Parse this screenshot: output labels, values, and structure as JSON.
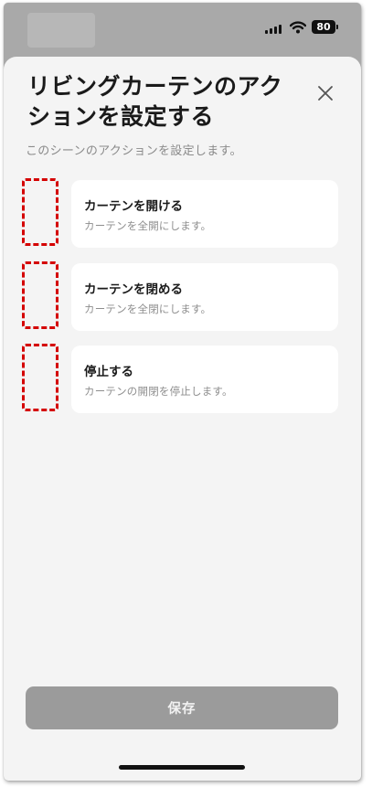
{
  "status_bar": {
    "battery_level": "80",
    "icons": [
      "cellular-signal-icon",
      "wifi-icon",
      "battery-icon"
    ]
  },
  "sheet": {
    "title": "リビングカーテンのアクションを設定する",
    "subtitle": "このシーンのアクションを設定します。",
    "close_icon": "close-icon"
  },
  "actions": [
    {
      "label": "カーテンを開ける",
      "description": "カーテンを全開にします。"
    },
    {
      "label": "カーテンを閉める",
      "description": "カーテンを全閉にします。"
    },
    {
      "label": "停止する",
      "description": "カーテンの開閉を停止します。"
    }
  ],
  "footer": {
    "save_label": "保存"
  },
  "colors": {
    "sheet_background": "#f4f4f4",
    "card_background": "#ffffff",
    "save_button_disabled": "#9b9b9b",
    "annotation_dashed_red": "#d40000"
  }
}
